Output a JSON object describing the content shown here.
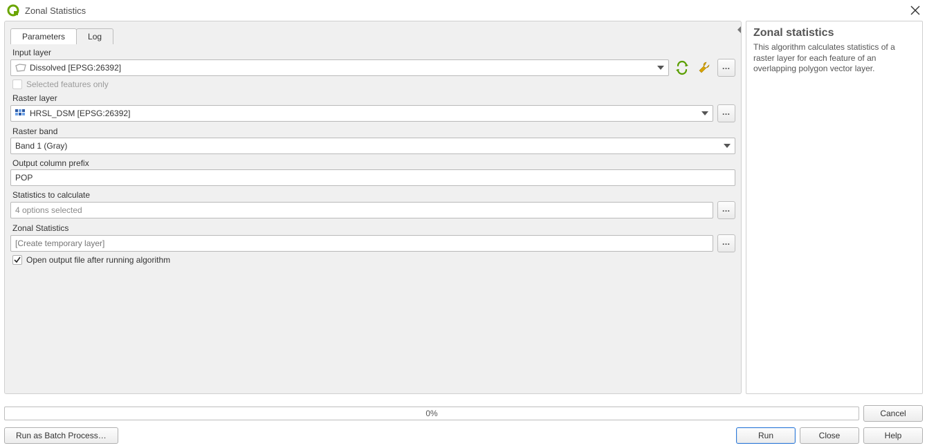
{
  "window": {
    "title": "Zonal Statistics"
  },
  "tabs": {
    "parameters": "Parameters",
    "log": "Log"
  },
  "labels": {
    "input_layer": "Input layer",
    "selected_only": "Selected features only",
    "raster_layer": "Raster layer",
    "raster_band": "Raster band",
    "output_prefix": "Output column prefix",
    "stats_to_calc": "Statistics to calculate",
    "zonal_stats_out": "Zonal Statistics",
    "open_output": "Open output file after running algorithm"
  },
  "values": {
    "input_layer": "Dissolved [EPSG:26392]",
    "raster_layer": "HRSL_DSM [EPSG:26392]",
    "raster_band": "Band 1 (Gray)",
    "output_prefix": "POP",
    "stats_summary": "4 options selected",
    "zonal_out_placeholder": "[Create temporary layer]",
    "selected_only_checked": false,
    "open_output_checked": true
  },
  "help": {
    "title": "Zonal statistics",
    "description": "This algorithm calculates statistics of a raster layer for each feature of an overlapping polygon vector layer."
  },
  "progress": {
    "text": "0%"
  },
  "buttons": {
    "cancel": "Cancel",
    "batch": "Run as Batch Process…",
    "run": "Run",
    "close": "Close",
    "help": "Help"
  },
  "icons": {
    "app": "qgis-icon",
    "close": "close-icon",
    "refresh": "refresh-icon",
    "wrench": "wrench-icon",
    "browse": "browse-icon",
    "polygon_layer": "polygon-layer-icon",
    "raster_layer": "raster-layer-icon",
    "caret_down": "caret-down-icon"
  }
}
